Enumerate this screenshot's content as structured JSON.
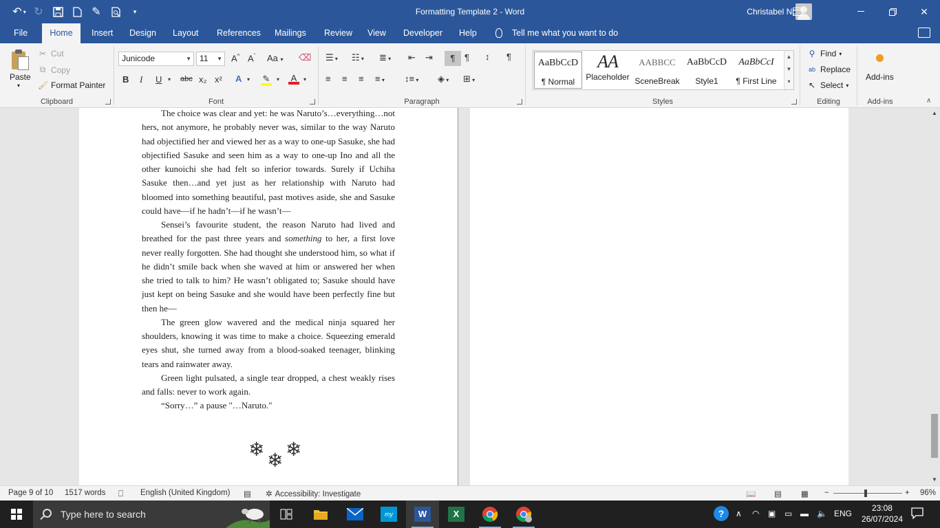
{
  "titlebar": {
    "doc_title": "Formatting Template 2  -  Word",
    "user_name": "Christabel Ndidi"
  },
  "tabs": [
    {
      "label": "File"
    },
    {
      "label": "Home"
    },
    {
      "label": "Insert"
    },
    {
      "label": "Design"
    },
    {
      "label": "Layout"
    },
    {
      "label": "References"
    },
    {
      "label": "Mailings"
    },
    {
      "label": "Review"
    },
    {
      "label": "View"
    },
    {
      "label": "Developer"
    },
    {
      "label": "Help"
    }
  ],
  "tell_me": "Tell me what you want to do",
  "clipboard": {
    "paste": "Paste",
    "cut": "Cut",
    "copy": "Copy",
    "format_painter": "Format Painter",
    "label": "Clipboard"
  },
  "font": {
    "name": "Junicode",
    "size": "11",
    "label": "Font",
    "bold": "B",
    "italic": "I",
    "underline": "U",
    "strike": "abc",
    "subscript": "x₂",
    "superscript": "x²",
    "grow": "A^",
    "shrink": "A˅",
    "case": "Aa",
    "highlight_color": "#ffff00",
    "font_color": "#e51c23"
  },
  "paragraph": {
    "label": "Paragraph"
  },
  "styles": {
    "label": "Styles",
    "items": [
      {
        "sample": "AaBbCcD",
        "name": "¶ Normal"
      },
      {
        "sample": "AA",
        "name": "Placeholder"
      },
      {
        "sample": "AABBCC",
        "name": "SceneBreak"
      },
      {
        "sample": "AaBbCcD",
        "name": "Style1"
      },
      {
        "sample": "AaBbCcI",
        "name": "¶ First Line"
      }
    ]
  },
  "editing": {
    "find": "Find",
    "replace": "Replace",
    "select": "Select",
    "label": "Editing"
  },
  "addins": {
    "button": "Add-ins",
    "label": "Add-ins"
  },
  "document": {
    "paragraphs": [
      "The choice was clear and yet: he was Naruto’s…everything…not hers, not anymore, he probably never was, similar to the way Naruto had objectified her and viewed her as a way to one-up Sasuke, she had objectified Sasuke and seen him as a way to one-up Ino and all the other kunoichi she had felt so inferior towards. Surely if Uchiha Sasuke then…and yet just as her relationship with Naruto had bloomed into something beautiful, past motives aside, she and Sasuke could have—if he hadn’t—if he wasn’t—",
      "Sensei’s favourite student, the reason Naruto had lived and breathed for the past three years and ",
      "something",
      " to her, a first love never really forgotten. She had thought she understood him, so what if he didn’t smile back when she waved at him or answered her when she tried to talk to him? He wasn’t obligated to; Sasuke should have just kept on being Sasuke and she would have been perfectly fine but then he—",
      "The green glow wavered and the medical ninja squared her shoulders, knowing it was time to make a choice. Squeezing emerald eyes shut, she turned away from a blood-soaked teenager, blinking tears and rainwater away.",
      "Green light pulsated, a single tear dropped, a chest weakly rises and falls: never to work again.",
      "“Sorry…” a pause \"…Naruto.\""
    ],
    "scene_break": "❄"
  },
  "statusbar": {
    "page": "Page 9 of 10",
    "words": "1517 words",
    "language": "English (United Kingdom)",
    "accessibility": "Accessibility: Investigate",
    "zoom": "96%"
  },
  "taskbar": {
    "search_placeholder": "Type here to search",
    "language": "ENG",
    "time": "23:08",
    "date": "26/07/2024"
  }
}
